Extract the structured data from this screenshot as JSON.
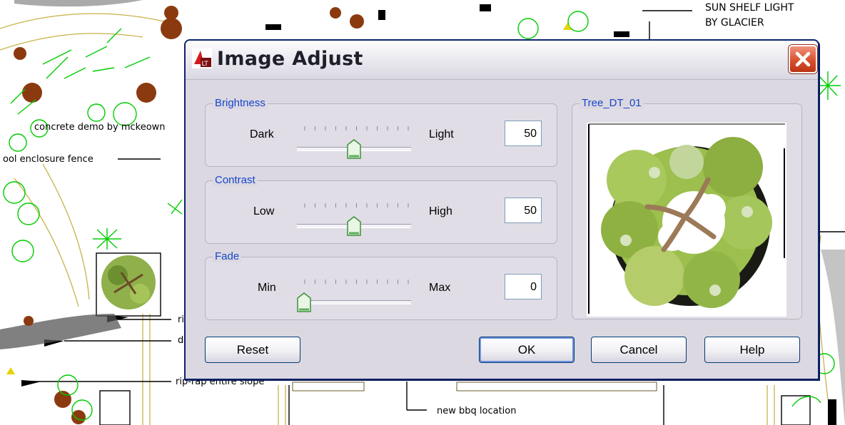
{
  "background": {
    "labels": {
      "sun_shelf_1": "SUN SHELF LIGHT",
      "sun_shelf_2": "BY GLACIER",
      "concrete_demo": "concrete demo by mckeown",
      "pool_fence": "ool enclosure fence",
      "rip1": "ri",
      "d1": "d",
      "rip_rap": "rip-rap entire slope",
      "bbq": "new bbq location"
    }
  },
  "dialog": {
    "title": "Image Adjust",
    "groups": {
      "brightness": {
        "legend": "Brightness",
        "min_label": "Dark",
        "max_label": "Light",
        "value": "50",
        "level": 0.5
      },
      "contrast": {
        "legend": "Contrast",
        "min_label": "Low",
        "max_label": "High",
        "value": "50",
        "level": 0.5
      },
      "fade": {
        "legend": "Fade",
        "min_label": "Min",
        "max_label": "Max",
        "value": "0",
        "level": 0.0
      }
    },
    "preview": {
      "legend": "Tree_DT_01"
    },
    "buttons": {
      "reset": "Reset",
      "ok": "OK",
      "cancel": "Cancel",
      "help": "Help"
    }
  },
  "colors": {
    "legend": "#1547c8",
    "close": "#d8502e",
    "cad_green": "#00cc00",
    "cad_brown": "#8b3a10"
  }
}
